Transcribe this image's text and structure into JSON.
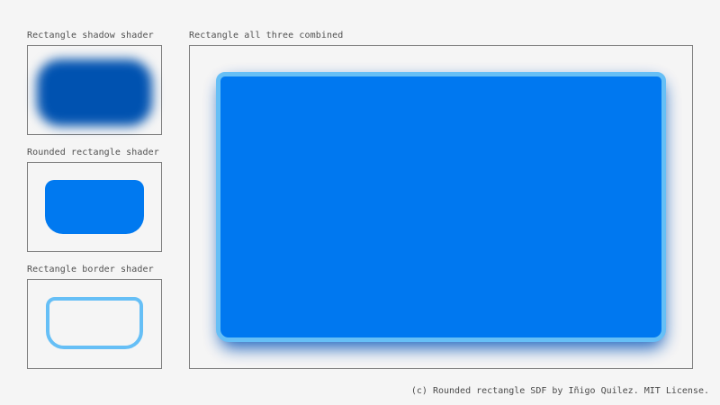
{
  "panels": {
    "shadow": {
      "label": "Rectangle shadow shader"
    },
    "rounded": {
      "label": "Rounded rectangle shader"
    },
    "border": {
      "label": "Rectangle border shader"
    },
    "combined": {
      "label": "Rectangle all three combined"
    }
  },
  "colors": {
    "background": "#f5f5f5",
    "panel_border": "#7e7e7e",
    "shadow": "#0052b0",
    "fill": "#0079f0",
    "border": "#66bff6"
  },
  "footer": {
    "credit": "(c) Rounded rectangle SDF by Iñigo Quilez. MIT License."
  }
}
